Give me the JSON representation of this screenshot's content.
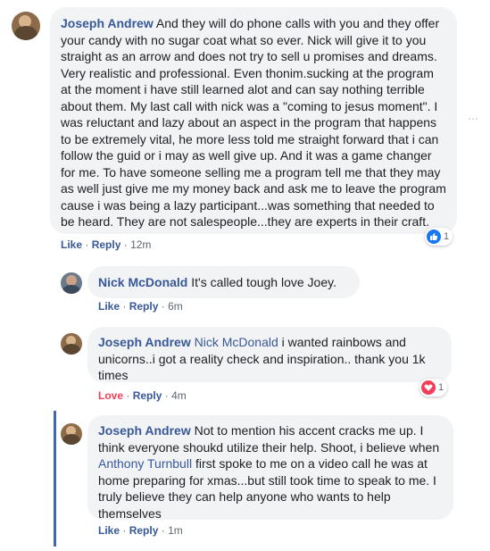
{
  "colors": {
    "link": "#385898",
    "bubble": "#f2f3f5",
    "like_blue": "#1877f2",
    "love_red": "#f33e58",
    "thread_line": "#4267b2"
  },
  "comments": [
    {
      "author": "Joseph Andrew",
      "mention": "",
      "text": "And they will do phone calls with you and they offer your candy with no sugar coat what so ever. Nick will give it to you straight as an arrow and does not try to sell u promises and dreams. Very realistic and professional. Even thonim.sucking at the program at the moment i have still learned alot and can say nothing terrible about them. My last call with nick was a \"coming to jesus moment\". I was reluctant and lazy about an aspect in the program that happens to be extremely vital, he more less told me straight forward that i can follow the guid or i may as well give up. And it was a game changer for me. To have someone selling me a program tell me that they may as well just give me my money back and ask me to leave the program cause i was being a lazy participant...was something that needed to be heard. They are not salespeople...they are experts in their craft.",
      "action_primary": "Like",
      "action_reply": "Reply",
      "time": "12m",
      "reaction_icon": "like-icon",
      "reaction_count": "1"
    },
    {
      "author": "Nick McDonald",
      "mention": "",
      "text": "It's called tough love Joey.",
      "action_primary": "Like",
      "action_reply": "Reply",
      "time": "6m"
    },
    {
      "author": "Joseph Andrew",
      "mention": "Nick McDonald",
      "text": "i wanted rainbows and unicorns..i got a reality check and inspiration.. thank you 1k times",
      "action_primary": "Love",
      "action_reply": "Reply",
      "time": "4m",
      "reaction_icon": "heart-icon",
      "reaction_count": "1"
    },
    {
      "author": "Joseph Andrew",
      "text_before": "Not to mention his accent cracks me up. I think everyone shoukd utilize their help. Shoot, i believe when",
      "mention": "Anthony Turnbull",
      "text_after": "first spoke to me on a video call he was at home preparing for xmas...but still took time to speak to me. I truly believe they can help anyone who wants to help themselves",
      "action_primary": "Like",
      "action_reply": "Reply",
      "time": "1m"
    }
  ]
}
